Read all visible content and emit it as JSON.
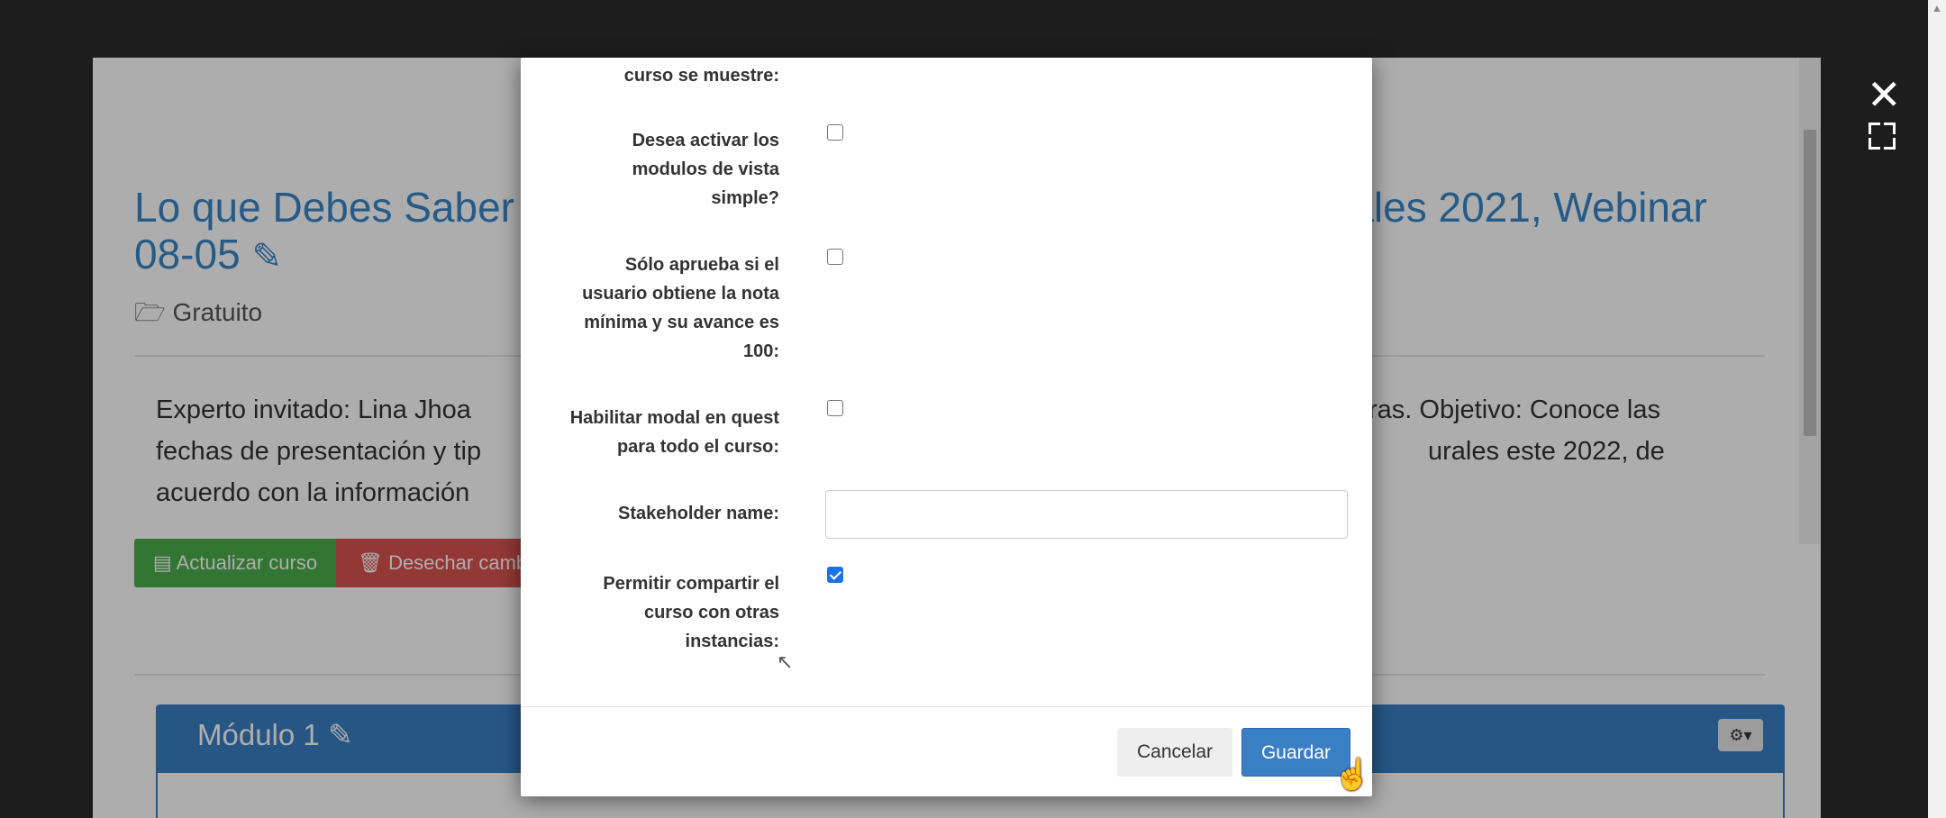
{
  "page": {
    "course_title_part1": "Lo que Debes Saber",
    "course_title_part2": "rales 2021, Webinar",
    "course_title_line2": "08-05",
    "category": "Gratuito",
    "description_line1_left": "Experto invitado: Lina Jhoa",
    "description_line1_right": "ras. Objetivo: Conoce las",
    "description_line2_left": "fechas de presentación y tip",
    "description_line2_right": "urales este 2022, de",
    "description_line3_left": "acuerdo con la información",
    "update_button": "Actualizar curso",
    "discard_button": "Desechar cambi",
    "module_title": "Módulo 1"
  },
  "lightbox": {
    "close_glyph": "✕"
  },
  "modal": {
    "top_label_fragment": "curso se muestre:",
    "fields": [
      {
        "label_lines": [
          "Desea activar los",
          "modulos de vista",
          "simple?"
        ],
        "checked": false
      },
      {
        "label_lines": [
          "Sólo aprueba si el",
          "usuario obtiene la nota",
          "mínima y su avance es",
          "100:"
        ],
        "checked": false
      },
      {
        "label_lines": [
          "Habilitar modal en quest",
          "para todo el curso:"
        ],
        "checked": false
      },
      {
        "label": "Stakeholder name:",
        "value": ""
      },
      {
        "label_lines": [
          "Permitir compartir el",
          "curso con otras",
          "instancias:"
        ],
        "checked": true
      }
    ],
    "cancel_button": "Cancelar",
    "save_button": "Guardar"
  },
  "colors": {
    "link_blue": "#3a87c8",
    "success_green": "#4cae4c",
    "danger_red": "#d9534f",
    "primary_blue": "#3a7fc4",
    "checkbox_checked": "#1a73e8"
  },
  "icons": [
    "edit-icon",
    "folder-open-icon",
    "book-icon",
    "trash-icon",
    "gear-icon",
    "close-icon",
    "fullscreen-icon"
  ]
}
